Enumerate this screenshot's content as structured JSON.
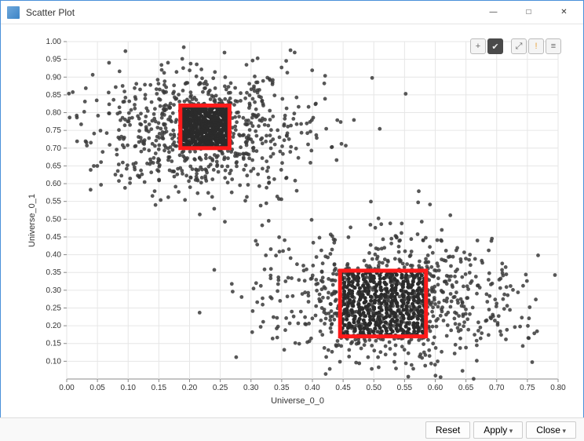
{
  "window": {
    "title": "Scatter Plot",
    "buttons": {
      "min": "—",
      "max": "□",
      "close": "✕"
    }
  },
  "toolbar": {
    "items": [
      {
        "name": "add-icon",
        "glyph": "+",
        "style": ""
      },
      {
        "name": "check-icon",
        "glyph": "✔",
        "style": "dark"
      },
      {
        "name": "expand-icon",
        "glyph": "⤢",
        "style": ""
      },
      {
        "name": "warn-icon",
        "glyph": "!",
        "style": "warn"
      },
      {
        "name": "list-icon",
        "glyph": "≡",
        "style": ""
      }
    ]
  },
  "footer": {
    "reset": "Reset",
    "apply": "Apply",
    "close": "Close"
  },
  "chart_data": {
    "type": "scatter",
    "title": "",
    "xlabel": "Universe_0_0",
    "ylabel": "Universe_0_1",
    "xlim": [
      0.0,
      0.8
    ],
    "ylim": [
      0.05,
      1.0
    ],
    "xticks": [
      0.0,
      0.05,
      0.1,
      0.15,
      0.2,
      0.25,
      0.3,
      0.35,
      0.4,
      0.45,
      0.5,
      0.55,
      0.6,
      0.65,
      0.7,
      0.75,
      0.8
    ],
    "yticks": [
      0.1,
      0.15,
      0.2,
      0.25,
      0.3,
      0.35,
      0.4,
      0.45,
      0.5,
      0.55,
      0.6,
      0.65,
      0.7,
      0.75,
      0.8,
      0.85,
      0.9,
      0.95,
      1.0
    ],
    "clusters": [
      {
        "cx": 0.22,
        "cy": 0.75,
        "sx": 0.095,
        "sy": 0.095,
        "n": 800
      },
      {
        "cx": 0.53,
        "cy": 0.27,
        "sx": 0.1,
        "sy": 0.095,
        "n": 900
      }
    ],
    "selections": [
      {
        "x0": 0.185,
        "x1": 0.265,
        "y0": 0.7,
        "y1": 0.82
      },
      {
        "x0": 0.445,
        "x1": 0.585,
        "y0": 0.17,
        "y1": 0.355
      }
    ]
  }
}
